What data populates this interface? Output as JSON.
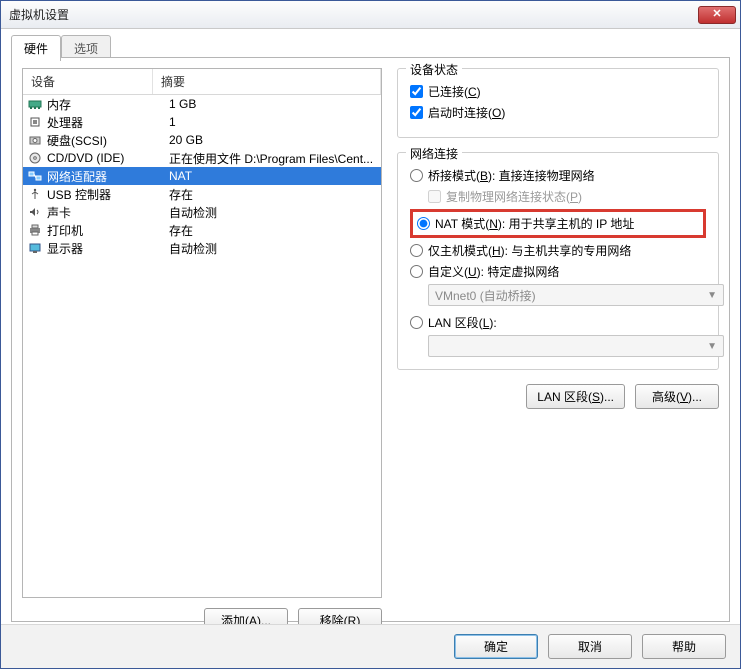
{
  "window": {
    "title": "虚拟机设置"
  },
  "tabs": {
    "active": "硬件",
    "inactive": "选项"
  },
  "list": {
    "header_device": "设备",
    "header_summary": "摘要",
    "rows": [
      {
        "dev": "内存",
        "sum": "1 GB"
      },
      {
        "dev": "处理器",
        "sum": "1"
      },
      {
        "dev": "硬盘(SCSI)",
        "sum": "20 GB"
      },
      {
        "dev": "CD/DVD (IDE)",
        "sum": "正在使用文件 D:\\Program Files\\Cent..."
      },
      {
        "dev": "网络适配器",
        "sum": "NAT"
      },
      {
        "dev": "USB 控制器",
        "sum": "存在"
      },
      {
        "dev": "声卡",
        "sum": "自动检测"
      },
      {
        "dev": "打印机",
        "sum": "存在"
      },
      {
        "dev": "显示器",
        "sum": "自动检测"
      }
    ]
  },
  "left_buttons": {
    "add": "添加(A)...",
    "remove": "移除(R)"
  },
  "device_state": {
    "legend": "设备状态",
    "connected_pre": "已连接(",
    "connected_u": "C",
    "connected_post": ")",
    "on_power_pre": "启动时连接(",
    "on_power_u": "O",
    "on_power_post": ")"
  },
  "net": {
    "legend": "网络连接",
    "bridge_pre": "桥接模式(",
    "bridge_u": "B",
    "bridge_post": "): 直接连接物理网络",
    "replicate_pre": "复制物理网络连接状态(",
    "replicate_u": "P",
    "replicate_post": ")",
    "nat_pre": "NAT 模式(",
    "nat_u": "N",
    "nat_post": "): 用于共享主机的 IP 地址",
    "host_pre": "仅主机模式(",
    "host_u": "H",
    "host_post": "): 与主机共享的专用网络",
    "custom_pre": "自定义(",
    "custom_u": "U",
    "custom_post": "): 特定虚拟网络",
    "custom_combo": "VMnet0 (自动桥接)",
    "lanseg_pre": "LAN 区段(",
    "lanseg_u": "L",
    "lanseg_post": "):",
    "lanseg_combo": "",
    "btn_lanseg_pre": "LAN 区段(",
    "btn_lanseg_u": "S",
    "btn_lanseg_post": ")...",
    "btn_adv_pre": "高级(",
    "btn_adv_u": "V",
    "btn_adv_post": ")..."
  },
  "footer": {
    "ok": "确定",
    "cancel": "取消",
    "help": "帮助"
  }
}
